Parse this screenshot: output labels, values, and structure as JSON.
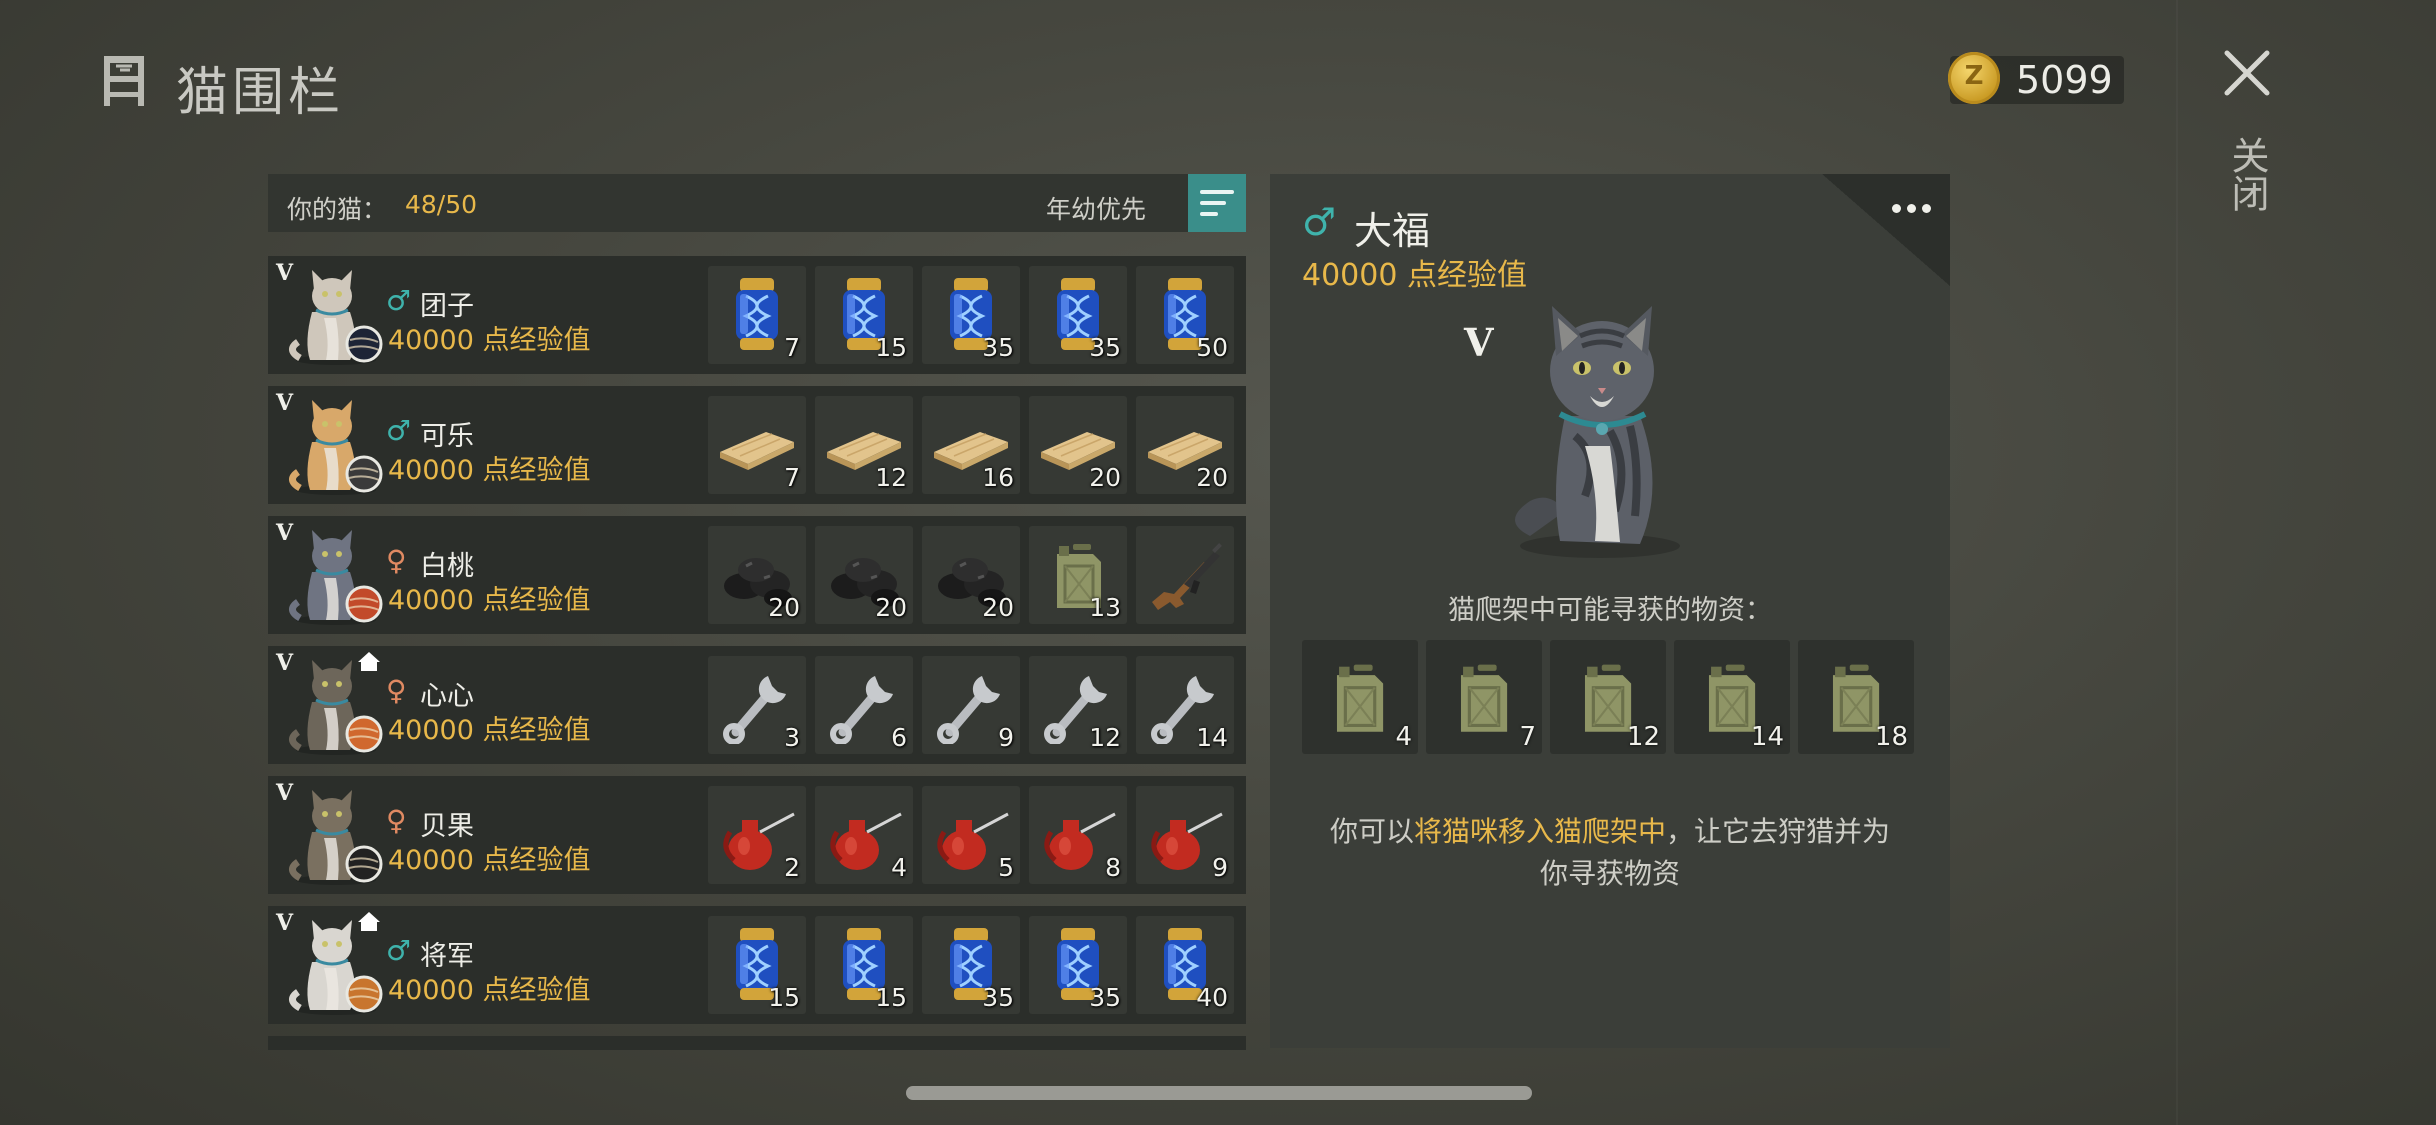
{
  "header": {
    "title": "猫围栏",
    "coins": "5099",
    "close_label": "关闭"
  },
  "list": {
    "count_label": "你的猫：",
    "count_value": "48/50",
    "sort_label": "年幼优先",
    "rows": [
      {
        "rank": "V",
        "gender": "♂",
        "gender_color": "#3fb3ac",
        "name": "团子",
        "exp": "40000 点经验值",
        "fur": "#cfc7bb",
        "ball": "#1d2436",
        "home": false,
        "items": [
          {
            "icon": "dna-capsule-icon",
            "qty": "7"
          },
          {
            "icon": "dna-capsule-icon",
            "qty": "15"
          },
          {
            "icon": "dna-capsule-icon",
            "qty": "35"
          },
          {
            "icon": "dna-capsule-icon",
            "qty": "35"
          },
          {
            "icon": "dna-capsule-icon",
            "qty": "50"
          }
        ]
      },
      {
        "rank": "V",
        "gender": "♂",
        "gender_color": "#3fb3ac",
        "name": "可乐",
        "exp": "40000 点经验值",
        "fur": "#d8a86a",
        "ball": "#3a3a3a",
        "home": false,
        "items": [
          {
            "icon": "wood-plank-icon",
            "qty": "7"
          },
          {
            "icon": "wood-plank-icon",
            "qty": "12"
          },
          {
            "icon": "wood-plank-icon",
            "qty": "16"
          },
          {
            "icon": "wood-plank-icon",
            "qty": "20"
          },
          {
            "icon": "wood-plank-icon",
            "qty": "20"
          }
        ]
      },
      {
        "rank": "V",
        "gender": "♀",
        "gender_color": "#e08a62",
        "name": "白桃",
        "exp": "40000 点经验值",
        "fur": "#6f7482",
        "ball": "#c24a2a",
        "home": false,
        "items": [
          {
            "icon": "coal-icon",
            "qty": "20"
          },
          {
            "icon": "coal-icon",
            "qty": "20"
          },
          {
            "icon": "coal-icon",
            "qty": "20"
          },
          {
            "icon": "jerrycan-icon",
            "qty": "13"
          },
          {
            "icon": "rifle-icon",
            "qty": ""
          }
        ]
      },
      {
        "rank": "V",
        "gender": "♀",
        "gender_color": "#e08a62",
        "name": "心心",
        "exp": "40000 点经验值",
        "fur": "#6d665a",
        "ball": "#d0682e",
        "home": true,
        "items": [
          {
            "icon": "wrench-icon",
            "qty": "3"
          },
          {
            "icon": "wrench-icon",
            "qty": "6"
          },
          {
            "icon": "wrench-icon",
            "qty": "9"
          },
          {
            "icon": "wrench-icon",
            "qty": "12"
          },
          {
            "icon": "wrench-icon",
            "qty": "14"
          }
        ]
      },
      {
        "rank": "V",
        "gender": "♀",
        "gender_color": "#e08a62",
        "name": "贝果",
        "exp": "40000 点经验值",
        "fur": "#7a7060",
        "ball": "#222222",
        "home": false,
        "items": [
          {
            "icon": "oil-can-icon",
            "qty": "2"
          },
          {
            "icon": "oil-can-icon",
            "qty": "4"
          },
          {
            "icon": "oil-can-icon",
            "qty": "5"
          },
          {
            "icon": "oil-can-icon",
            "qty": "8"
          },
          {
            "icon": "oil-can-icon",
            "qty": "9"
          }
        ]
      },
      {
        "rank": "V",
        "gender": "♂",
        "gender_color": "#3fb3ac",
        "name": "将军",
        "exp": "40000 点经验值",
        "fur": "#d9d6d0",
        "ball": "#c8752e",
        "home": true,
        "items": [
          {
            "icon": "dna-capsule-icon",
            "qty": "15"
          },
          {
            "icon": "dna-capsule-icon",
            "qty": "15"
          },
          {
            "icon": "dna-capsule-icon",
            "qty": "35"
          },
          {
            "icon": "dna-capsule-icon",
            "qty": "35"
          },
          {
            "icon": "dna-capsule-icon",
            "qty": "40"
          }
        ]
      }
    ]
  },
  "detail": {
    "gender": "♂",
    "name": "大福",
    "exp": "40000 点经验值",
    "rank": "V",
    "loot_title": "猫爬架中可能寻获的物资：",
    "loot": [
      {
        "icon": "jerrycan-icon",
        "qty": "4"
      },
      {
        "icon": "jerrycan-icon",
        "qty": "7"
      },
      {
        "icon": "jerrycan-icon",
        "qty": "12"
      },
      {
        "icon": "jerrycan-icon",
        "qty": "14"
      },
      {
        "icon": "jerrycan-icon",
        "qty": "18"
      }
    ],
    "hint_prefix": "你可以",
    "hint_highlight": "将猫咪移入猫爬架中",
    "hint_suffix": "，让它去狩猎并为",
    "hint_line2": "你寻获物资"
  },
  "colors": {
    "accent_gold": "#e8b84a",
    "accent_teal": "#3a8e8a",
    "male": "#3fb3ac",
    "female": "#e08a62"
  }
}
